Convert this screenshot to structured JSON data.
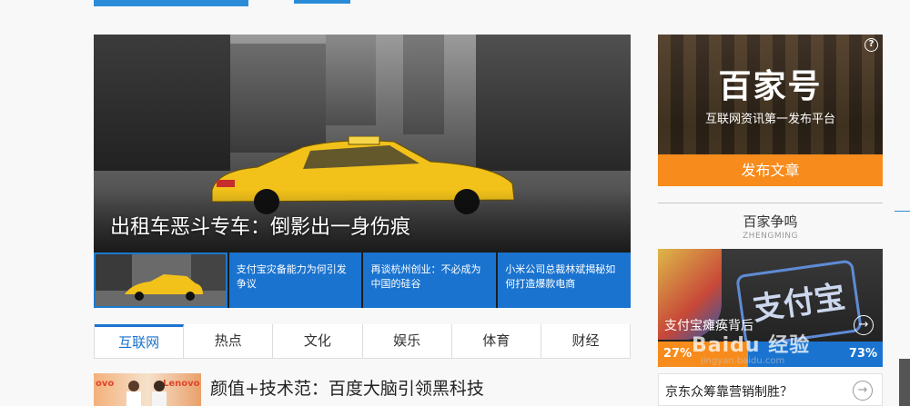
{
  "hero": {
    "caption": "出租车恶斗专车：倒影出一身伤痕"
  },
  "thumb_strip": {
    "items": [
      {
        "text": "支付宝灾备能力为何引发争议"
      },
      {
        "text": "再谈杭州创业：不必成为中国的硅谷"
      },
      {
        "text": "小米公司总裁林斌揭秘如何打造爆款电商"
      }
    ]
  },
  "tabs": [
    "互联网",
    "热点",
    "文化",
    "娱乐",
    "体育",
    "财经"
  ],
  "active_tab": "互联网",
  "news": {
    "title": "颜值+技术范：百度大脑引领黑科技",
    "thumb_brand": "ovo",
    "thumb_brand2": "Lenovo"
  },
  "baijiahao": {
    "help": "?",
    "brand": "百家号",
    "slogan": "互联网资讯第一发布平台",
    "publish_label": "发布文章"
  },
  "zhengming": {
    "title": "百家争鸣",
    "subtitle": "ZHENGMING",
    "card_headline": "支付宝瘫痪背后",
    "card_sign": "支付宝",
    "vote_left": "27%",
    "vote_right": "73%",
    "second_headline": "京东众筹靠营销制胜？"
  },
  "watermark": {
    "text": "Baidu 经验",
    "url": "jingyan.baidu.com"
  },
  "icons": {
    "arrow": "→"
  },
  "colors": {
    "accent_blue": "#1a73cf",
    "accent_orange": "#f78b1b"
  }
}
